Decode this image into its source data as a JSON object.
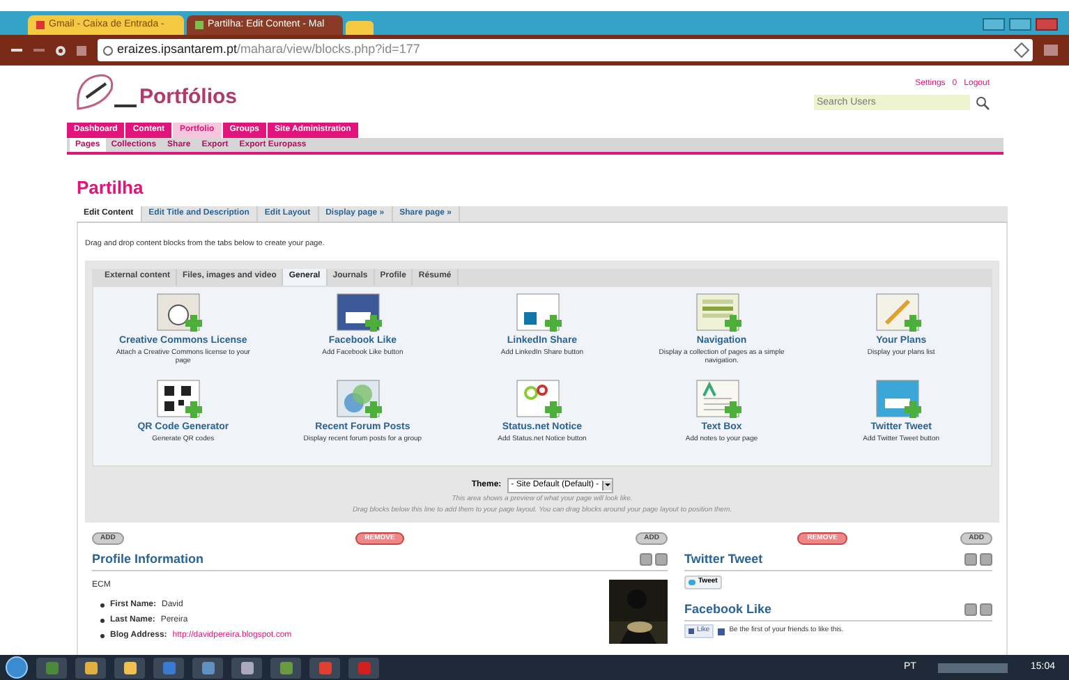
{
  "browser": {
    "tabs": [
      {
        "label": "Gmail - Caixa de Entrada - ",
        "selected": false
      },
      {
        "label": "Partilha: Edit Content - Mal",
        "selected": true
      }
    ],
    "address": {
      "host": "eraizes.ipsantarem.pt",
      "path": "/mahara/view/blocks.php?id=177"
    }
  },
  "site": {
    "logo": "Portfólios",
    "user_links": [
      "Settings",
      "0",
      "Logout"
    ],
    "search": {
      "placeholder": "Search Users"
    },
    "nav": [
      {
        "label": "Dashboard",
        "selected": false
      },
      {
        "label": "Content",
        "selected": false
      },
      {
        "label": "Portfolio",
        "selected": true
      },
      {
        "label": "Groups",
        "selected": false
      },
      {
        "label": "Site Administration",
        "selected": false
      }
    ],
    "subnav": [
      {
        "label": "Pages",
        "selected": true
      },
      {
        "label": "Collections",
        "selected": false
      },
      {
        "label": "Share",
        "selected": false
      },
      {
        "label": "Export",
        "selected": false
      },
      {
        "label": "Export Europass",
        "selected": false
      }
    ]
  },
  "page": {
    "title": "Partilha",
    "tabs": [
      {
        "label": "Edit Content",
        "selected": true
      },
      {
        "label": "Edit Title and Description",
        "selected": false
      },
      {
        "label": "Edit Layout",
        "selected": false
      },
      {
        "label": "Display page »",
        "selected": false
      },
      {
        "label": "Share page »",
        "selected": false
      }
    ],
    "intro": "Drag and drop content blocks from the tabs below to create your page.",
    "block_tabs": [
      {
        "label": "External content",
        "selected": false
      },
      {
        "label": "Files, images and video",
        "selected": false
      },
      {
        "label": "General",
        "selected": true
      },
      {
        "label": "Journals",
        "selected": false
      },
      {
        "label": "Profile",
        "selected": false
      },
      {
        "label": "Résumé",
        "selected": false
      }
    ],
    "blocks": [
      {
        "title": "Creative Commons License",
        "description": "Attach a Creative Commons license to your page"
      },
      {
        "title": "Facebook Like",
        "description": "Add Facebook Like button"
      },
      {
        "title": "LinkedIn Share",
        "description": "Add LinkedIn Share button"
      },
      {
        "title": "Navigation",
        "description": "Display a collection of pages as a simple navigation."
      },
      {
        "title": "Your Plans",
        "description": "Display your plans list"
      },
      {
        "title": "QR Code Generator",
        "description": "Generate QR codes"
      },
      {
        "title": "Recent Forum Posts",
        "description": "Display recent forum posts for a group"
      },
      {
        "title": "Status.net Notice",
        "description": "Add Status.net Notice button"
      },
      {
        "title": "Text Box",
        "description": "Add notes to your page"
      },
      {
        "title": "Twitter Tweet",
        "description": "Add Twitter Tweet button"
      }
    ],
    "theme": {
      "label": "Theme:",
      "value": "- Site Default (Default) -"
    },
    "hints": [
      "This area shows a preview of what your page will look like.",
      "Drag blocks below this line to add them to your page layout. You can drag blocks around your page layout to position them."
    ],
    "columns": [
      {
        "add_left": "ADD",
        "remove": "REMOVE",
        "add_right": "ADD",
        "blocks": [
          {
            "kind": "profile",
            "title": "Profile Information",
            "text": "ECM",
            "fields": [
              {
                "label": "First Name:",
                "value": "David",
                "link": false
              },
              {
                "label": "Last Name:",
                "value": "Pereira",
                "link": false
              },
              {
                "label": "Blog Address:",
                "value": "http://davidpereira.blogspot.com",
                "link": true
              }
            ]
          }
        ]
      },
      {
        "remove": "REMOVE",
        "add_right": "ADD",
        "blocks": [
          {
            "kind": "tweet",
            "title": "Twitter Tweet",
            "button": "Tweet"
          },
          {
            "kind": "like",
            "title": "Facebook Like",
            "button": "Like",
            "text": "Be the first of your friends to like this."
          }
        ]
      }
    ]
  },
  "taskbar": {
    "language": "PT",
    "clock": "15:04"
  }
}
